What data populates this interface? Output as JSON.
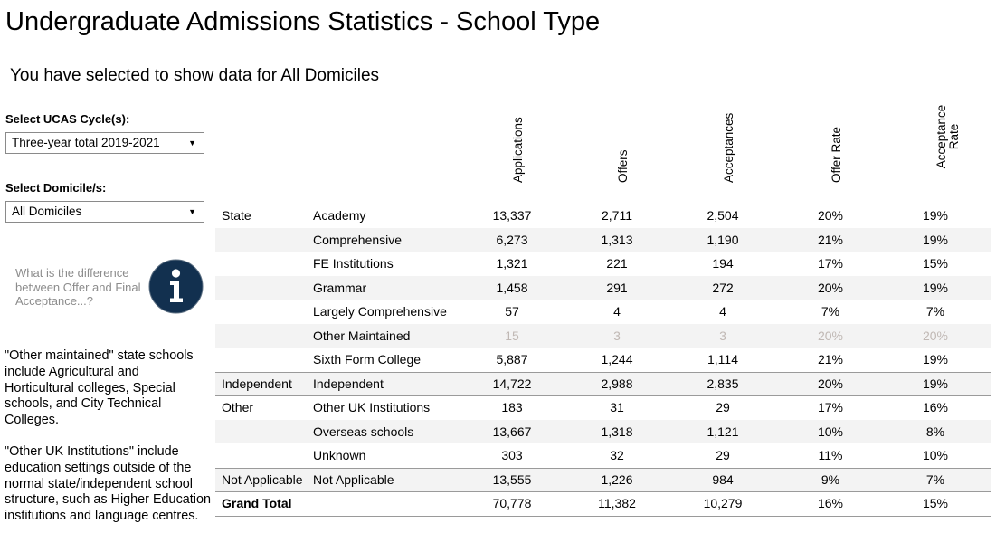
{
  "header": {
    "title": "Undergraduate Admissions Statistics - School Type",
    "subtitle": "You have selected to show data for All Domiciles"
  },
  "filters": {
    "cycle_label": "Select UCAS Cycle(s):",
    "cycle_value": "Three-year total 2019-2021",
    "domicile_label": "Select Domicile/s:",
    "domicile_value": "All Domiciles"
  },
  "help": {
    "text": "What is the difference between Offer and Final Acceptance...?",
    "icon": "info-icon"
  },
  "notes": [
    "\"Other maintained\" state schools include Agricultural and Horticultural colleges, Special schools, and City Technical Colleges.",
    "\"Other UK Institutions\" include education settings outside of the normal state/independent school structure, such as Higher Education institutions and language centres."
  ],
  "table": {
    "columns": [
      "Applications",
      "Offers",
      "Acceptances",
      "Offer Rate",
      "Acceptance Rate"
    ],
    "rows": [
      {
        "group": "State",
        "school": "Academy",
        "values": [
          "13,337",
          "2,711",
          "2,504",
          "20%",
          "19%"
        ]
      },
      {
        "group": "",
        "school": "Comprehensive",
        "values": [
          "6,273",
          "1,313",
          "1,190",
          "21%",
          "19%"
        ]
      },
      {
        "group": "",
        "school": "FE Institutions",
        "values": [
          "1,321",
          "221",
          "194",
          "17%",
          "15%"
        ]
      },
      {
        "group": "",
        "school": "Grammar",
        "values": [
          "1,458",
          "291",
          "272",
          "20%",
          "19%"
        ]
      },
      {
        "group": "",
        "school": "Largely Comprehensive",
        "values": [
          "57",
          "4",
          "4",
          "7%",
          "7%"
        ]
      },
      {
        "group": "",
        "school": "Other Maintained",
        "values": [
          "15",
          "3",
          "3",
          "20%",
          "20%"
        ]
      },
      {
        "group": "",
        "school": "Sixth Form College",
        "values": [
          "5,887",
          "1,244",
          "1,114",
          "21%",
          "19%"
        ]
      },
      {
        "group": "Independent",
        "school": "Independent",
        "values": [
          "14,722",
          "2,988",
          "2,835",
          "20%",
          "19%"
        ]
      },
      {
        "group": "Other",
        "school": "Other UK Institutions",
        "values": [
          "183",
          "31",
          "29",
          "17%",
          "16%"
        ]
      },
      {
        "group": "",
        "school": "Overseas schools",
        "values": [
          "13,667",
          "1,318",
          "1,121",
          "10%",
          "8%"
        ]
      },
      {
        "group": "",
        "school": "Unknown",
        "values": [
          "303",
          "32",
          "29",
          "11%",
          "10%"
        ]
      },
      {
        "group": "Not Applicable",
        "school": "Not Applicable",
        "values": [
          "13,555",
          "1,226",
          "984",
          "9%",
          "7%"
        ]
      },
      {
        "group": "Grand Total",
        "school": "",
        "values": [
          "70,778",
          "11,382",
          "10,279",
          "16%",
          "15%"
        ]
      }
    ]
  },
  "colors": {
    "muted_text": "#c0b8b4",
    "row_shade": "#f3f3f3",
    "info_icon": "#12304f",
    "help_text": "#8c8c8c"
  }
}
